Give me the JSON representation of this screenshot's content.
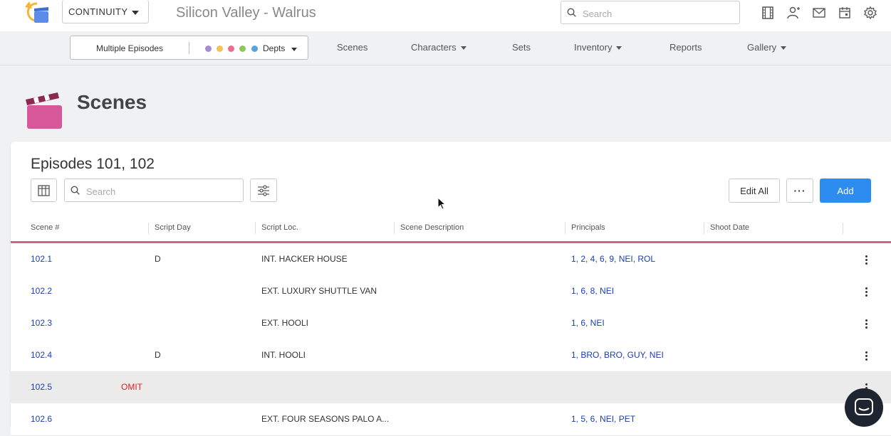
{
  "topbar": {
    "product": "CONTINUITY",
    "show_title": "Silicon Valley - Walrus",
    "search_placeholder": "Search"
  },
  "navbar": {
    "episode_switch": "Multiple Episodes",
    "depts_label": "Depts",
    "dept_colors": [
      "#a98bd3",
      "#f2c25b",
      "#e8708e",
      "#8dc85a",
      "#5aa1e0"
    ],
    "links": {
      "scenes": "Scenes",
      "characters": "Characters",
      "sets": "Sets",
      "inventory": "Inventory",
      "reports": "Reports",
      "gallery": "Gallery"
    }
  },
  "page": {
    "title": "Scenes"
  },
  "card": {
    "title": "Episodes 101, 102",
    "search_placeholder": "Search",
    "edit_all": "Edit All",
    "more": "···",
    "add": "Add"
  },
  "table": {
    "columns": {
      "scene": "Scene #",
      "script_day": "Script Day",
      "script_loc": "Script Loc.",
      "description": "Scene Description",
      "principals": "Principals",
      "shoot_date": "Shoot Date"
    },
    "rows": [
      {
        "scene": "102.1",
        "omit": "",
        "day": "D",
        "loc": "INT. HACKER HOUSE",
        "principals": "1, 2, 4, 6, 9, NEI, ROL"
      },
      {
        "scene": "102.2",
        "omit": "",
        "day": "",
        "loc": "EXT. LUXURY SHUTTLE VAN",
        "principals": "1, 6, 8, NEI"
      },
      {
        "scene": "102.3",
        "omit": "",
        "day": "",
        "loc": "EXT. HOOLI",
        "principals": "1, 6, NEI"
      },
      {
        "scene": "102.4",
        "omit": "",
        "day": "D",
        "loc": "INT. HOOLI",
        "principals": "1, BRO, BRO, GUY, NEI"
      },
      {
        "scene": "102.5",
        "omit": "OMIT",
        "day": "",
        "loc": "",
        "principals": ""
      },
      {
        "scene": "102.6",
        "omit": "",
        "day": "",
        "loc": "EXT. FOUR SEASONS PALO A...",
        "principals": "1, 5, 6, NEI, PET"
      }
    ]
  }
}
